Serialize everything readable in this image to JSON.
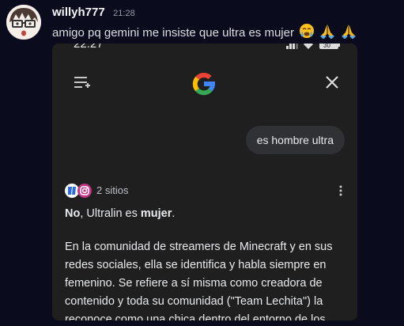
{
  "message": {
    "username": "willyh777",
    "timestamp": "21:28",
    "text": "amigo pq gemini me insiste que ultra es mujer",
    "emojis": [
      "crying-face",
      "folded-hands",
      "folded-hands"
    ]
  },
  "attachment": {
    "status_time": "22:27",
    "battery_level": "30",
    "user_query": "es hombre ultra",
    "sources_label": "2 sitios",
    "answer": {
      "no_word": "No",
      "mid_text": ", Ultralin es ",
      "emph_word": "mujer",
      "end_text": "."
    },
    "paragraph": "En la comunidad de streamers de Minecraft y en sus redes sociales, ella se identifica y habla siempre en femenino. Se refiere a sí misma como creadora de contenido y toda su comunidad (\"Team Lechita\") la reconoce como una chica dentro del entorno de los"
  },
  "colors": {
    "background": "#0b0b1e",
    "card": "#1f1f1f",
    "bubble": "#303134",
    "google_blue": "#4285f4",
    "google_red": "#ea4335",
    "google_yellow": "#fbbc05",
    "google_green": "#34a853"
  }
}
